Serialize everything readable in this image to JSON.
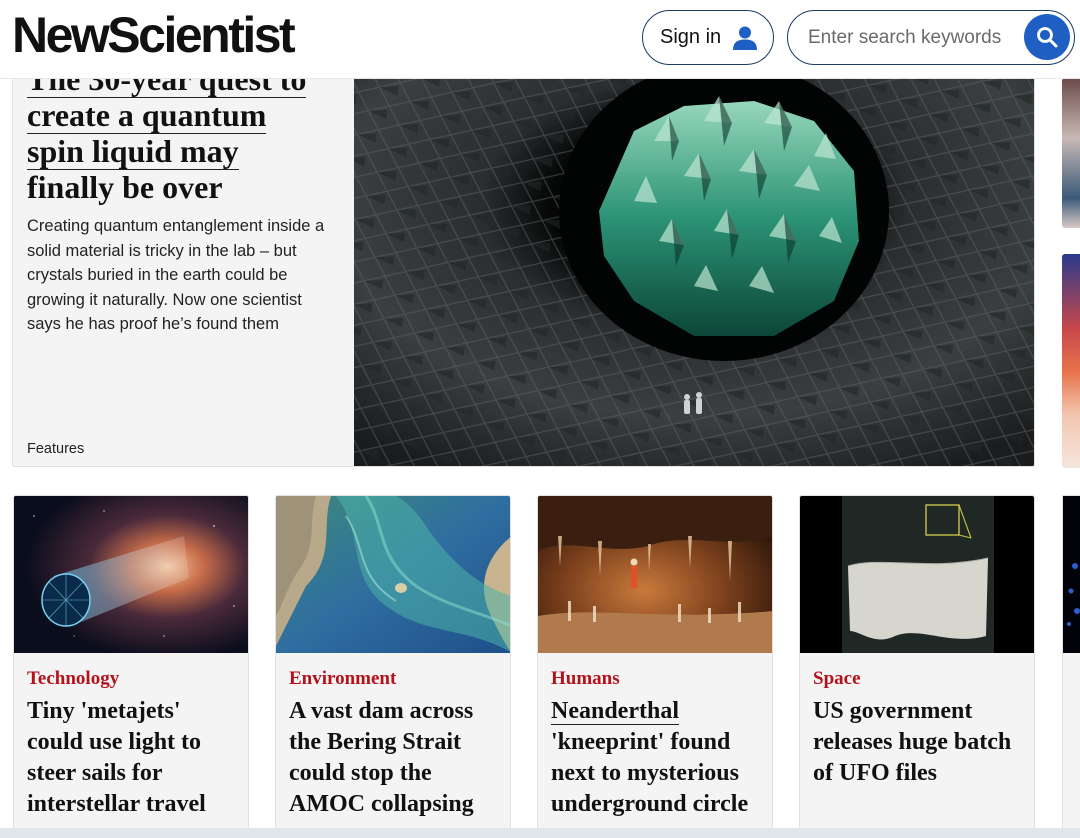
{
  "header": {
    "logo": "NewScientist",
    "sign_in": "Sign in",
    "search_placeholder": "Enter search keywords"
  },
  "hero": {
    "title_line1": "The 30-year quest to",
    "title_line2": "create a quantum",
    "title_line3": "spin liquid may",
    "title_line4": "finally be over",
    "summary": "Creating quantum entanglement inside a solid material is tricky in the lab – but crystals buried in the earth could be growing it naturally. Now one scientist says he has proof he’s found them",
    "section": "Features"
  },
  "cards": [
    {
      "category": "Technology",
      "title": "Tiny 'metajets' could use light to steer sails for interstellar travel"
    },
    {
      "category": "Environment",
      "title": "A vast dam across the Bering Strait could stop the AMOC collapsing"
    },
    {
      "category": "Humans",
      "title_first": "Neanderthal",
      "title_rest": " 'kneeprint' found next to mysterious underground circle"
    },
    {
      "category": "Space",
      "title": "US government releases huge batch of UFO files"
    }
  ],
  "colors": {
    "category": "#b3121b",
    "button_border": "#1d3a64",
    "search_button": "#1f5fc4"
  },
  "icons": [
    "person-icon",
    "search-icon"
  ]
}
